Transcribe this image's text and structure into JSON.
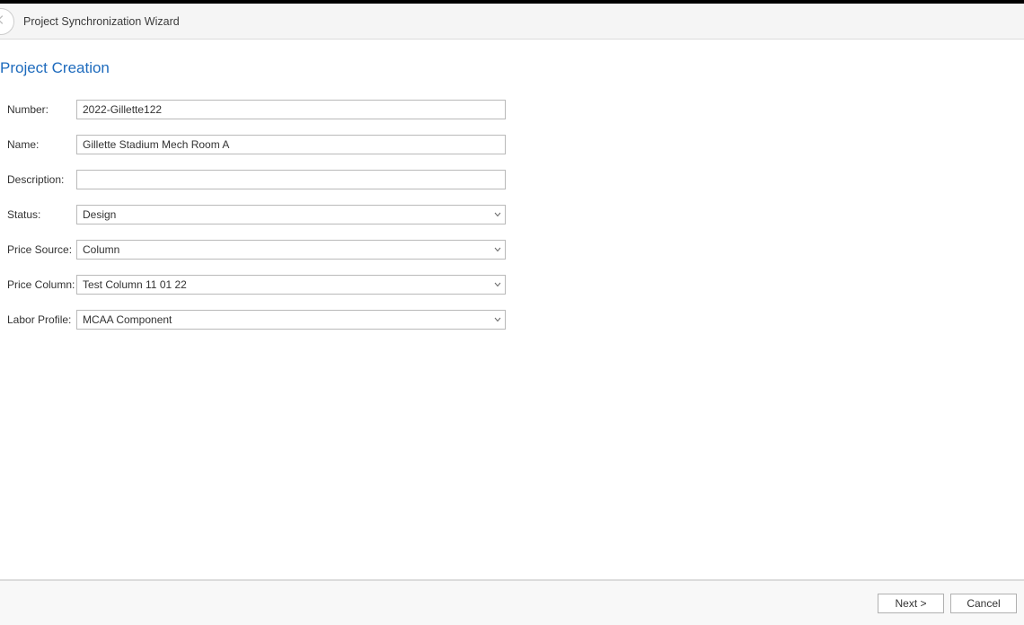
{
  "window": {
    "title": "Project Synchronization Wizard"
  },
  "page": {
    "heading": "Project Creation"
  },
  "form": {
    "number": {
      "label": "Number:",
      "value": "2022-Gillette122"
    },
    "name": {
      "label": "Name:",
      "value": "Gillette Stadium Mech Room A"
    },
    "description": {
      "label": "Description:",
      "value": ""
    },
    "status": {
      "label": "Status:",
      "value": "Design"
    },
    "price_source": {
      "label": "Price Source:",
      "value": "Column"
    },
    "price_column": {
      "label": "Price Column:",
      "value": "Test Column 11 01 22"
    },
    "labor_profile": {
      "label": "Labor Profile:",
      "value": "MCAA Component"
    }
  },
  "footer": {
    "next": "Next >",
    "cancel": "Cancel"
  }
}
